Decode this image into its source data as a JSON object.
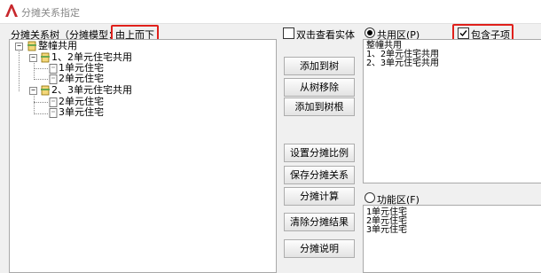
{
  "window": {
    "title": "分摊关系指定"
  },
  "header": {
    "tree_label": "分摊关系树（分摊模型：",
    "model_value": "由上而下"
  },
  "tree": {
    "root": "整幢共用",
    "groups": [
      {
        "label": "1、2单元住宅共用",
        "children": [
          "1单元住宅",
          "2单元住宅"
        ]
      },
      {
        "label": "2、3单元住宅共用",
        "children": [
          "2单元住宅",
          "3单元住宅"
        ]
      }
    ]
  },
  "options": {
    "double_click_view": "双击查看实体",
    "include_children": "包含子项"
  },
  "buttons": {
    "add_to_tree": "添加到树",
    "remove_from_tree": "从树移除",
    "add_to_root": "添加到树根",
    "set_ratio": "设置分摊比例",
    "save_relation": "保存分摊关系",
    "calculate": "分摊计算",
    "clear_result": "清除分摊结果",
    "explain": "分摊说明"
  },
  "public_area": {
    "label": "共用区(P)",
    "selected": true,
    "items": [
      "整幢共用",
      "1、2单元住宅共用",
      "2、3单元住宅共用"
    ]
  },
  "function_area": {
    "label": "功能区(F)",
    "selected": false,
    "items": [
      "1单元住宅",
      "2单元住宅",
      "3单元住宅"
    ]
  },
  "colors": {
    "highlight_border": "#e0201b",
    "app_icon": "#c8282d",
    "folder": "#e8c34a"
  }
}
